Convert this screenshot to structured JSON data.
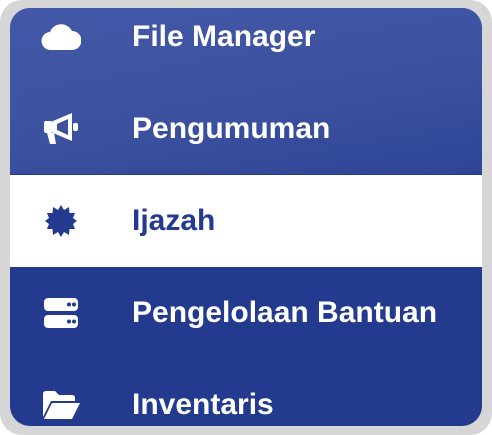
{
  "sidebar": {
    "items": [
      {
        "label": "File Manager",
        "icon": "cloud-icon",
        "active": false
      },
      {
        "label": "Pengumuman",
        "icon": "megaphone-icon",
        "active": false
      },
      {
        "label": "Ijazah",
        "icon": "certificate-icon",
        "active": true
      },
      {
        "label": "Pengelolaan Bantuan",
        "icon": "server-icon",
        "active": false
      },
      {
        "label": "Inventaris",
        "icon": "folder-open-icon",
        "active": false
      }
    ],
    "colors": {
      "background": "#243a8e",
      "top_band": "#3c529f",
      "active_background": "#ffffff",
      "active_text": "#243a8e",
      "text": "#ffffff"
    }
  }
}
